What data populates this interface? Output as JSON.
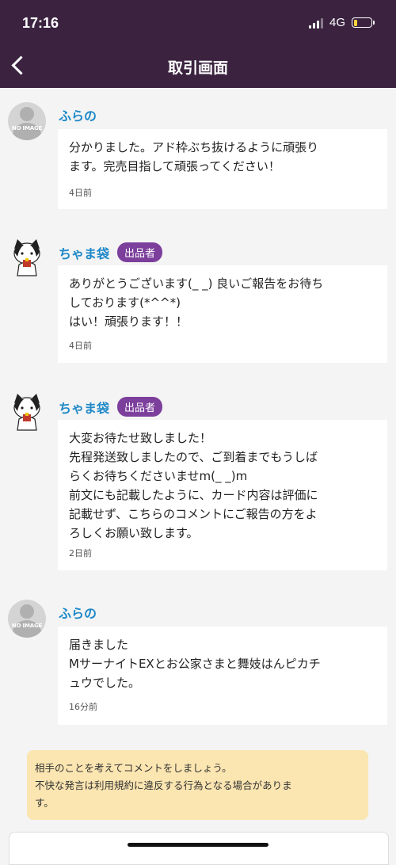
{
  "status": {
    "time": "17:16",
    "network": "4G",
    "battery_level": 0.2
  },
  "header": {
    "title": "取引画面"
  },
  "messages": [
    {
      "user": "ふらの",
      "avatar_text": "NO IMAGE",
      "text": "分かりました。アド枠ぶち抜けるように頑張り\nます。完売目指して頑張ってください！",
      "time": "4日前"
    },
    {
      "user": "ちゃま袋",
      "badge": "出品者",
      "text": "ありがとうございます(_ _) 良いご報告をお待ち\nしております(*^^*)\nはい！頑張ります！！",
      "time": "4日前"
    },
    {
      "user": "ちゃま袋",
      "badge": "出品者",
      "text": "大変お待たせ致しました！\n先程発送致しましたので、ご到着までもうしば\nらくお待ちくださいませm(_ _)m\n前文にも記載したように、カード内容は評価に\n記載せず、こちらのコメントにご報告の方をよ\nろしくお願い致します。",
      "time": "2日前"
    },
    {
      "user": "ふらの",
      "avatar_text": "NO IMAGE",
      "text": "届きました\nMサーナイトEXとお公家さまと舞妓はんピカチ\nュウでした。",
      "time": "16分前"
    }
  ],
  "notice": {
    "text": "相手のことを考えてコメントをしましょう。\n不快な発言は利用規約に違反する行為となる場合がありま\nす。"
  }
}
